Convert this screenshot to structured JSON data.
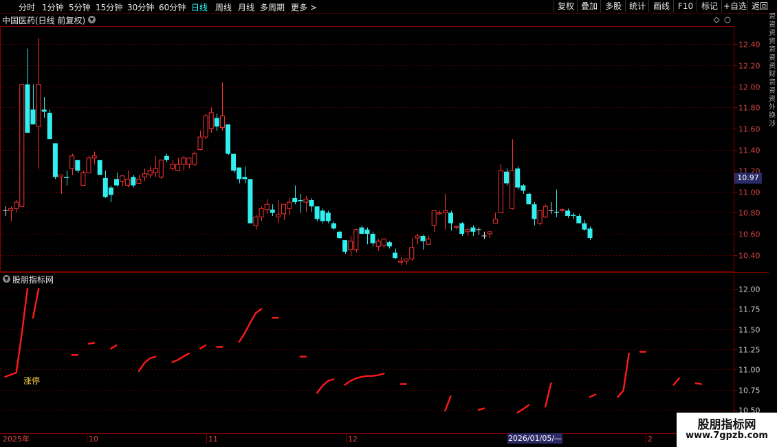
{
  "toolbar": {
    "periods": [
      "分时",
      "1分钟",
      "5分钟",
      "15分钟",
      "30分钟",
      "60分钟",
      "日线",
      "周线",
      "月线",
      "多周期",
      "更多 >"
    ],
    "active_period": "日线",
    "right_buttons": [
      "复权",
      "叠加",
      "多股",
      "统计",
      "画线",
      "F10",
      "标记",
      "+自选",
      "返回"
    ]
  },
  "upper_title": "中国医药(日线 前复权)",
  "lower_title": "股朋指标网",
  "current_price_label": "10.97",
  "crosshair_date": "2026/01/05/—",
  "limit_up_label": "涨停",
  "watermark": {
    "line1": "股朋指标网",
    "line2": "www.7gpzb.com"
  },
  "x_axis_labels": [
    "2025年",
    "10",
    "11",
    "12",
    "2"
  ],
  "right_strip_text": "资资资资资资资财资资资外换涉",
  "colors": {
    "up": "#ff3333",
    "down": "#33eeee",
    "line": "#ff1a1a",
    "grid": "#5a0000",
    "frame": "#8a0000"
  },
  "chart_data": [
    {
      "type": "candlestick",
      "title": "中国医药(日线 前复权)",
      "y_ticks": [
        "12.40",
        "12.20",
        "12.00",
        "11.80",
        "11.60",
        "11.40",
        "11.20",
        "11.00",
        "10.80",
        "10.60",
        "10.40"
      ],
      "ylim": [
        10.26,
        12.56
      ],
      "candles": [
        [
          10.82,
          10.86,
          10.77,
          10.82
        ],
        [
          10.82,
          10.86,
          10.72,
          10.84
        ],
        [
          10.84,
          10.92,
          10.8,
          10.9
        ],
        [
          10.86,
          12.02,
          10.86,
          12.02
        ],
        [
          12.02,
          12.36,
          11.56,
          11.56
        ],
        [
          11.78,
          12.02,
          11.64,
          11.64
        ],
        [
          11.62,
          12.46,
          11.22,
          12.02
        ],
        [
          11.78,
          11.9,
          11.7,
          11.76
        ],
        [
          11.75,
          11.78,
          11.5,
          11.5
        ],
        [
          11.46,
          11.46,
          11.12,
          11.14
        ],
        [
          11.14,
          11.16,
          10.98,
          11.16
        ],
        [
          11.14,
          11.2,
          11.06,
          11.13
        ],
        [
          11.22,
          11.36,
          11.16,
          11.34
        ],
        [
          11.3,
          11.3,
          11.18,
          11.2
        ],
        [
          11.06,
          11.2,
          11.06,
          11.18
        ],
        [
          11.18,
          11.34,
          11.18,
          11.32
        ],
        [
          11.32,
          11.38,
          11.26,
          11.34
        ],
        [
          11.3,
          11.3,
          11.16,
          11.16
        ],
        [
          11.13,
          11.2,
          10.94,
          10.95
        ],
        [
          11.04,
          11.06,
          10.9,
          10.97
        ],
        [
          11.12,
          11.18,
          11.05,
          11.06
        ],
        [
          11.1,
          11.16,
          11.05,
          11.15
        ],
        [
          11.06,
          11.2,
          11.04,
          11.12
        ],
        [
          11.14,
          11.16,
          11.04,
          11.06
        ],
        [
          11.08,
          11.16,
          11.07,
          11.12
        ],
        [
          11.14,
          11.22,
          11.1,
          11.17
        ],
        [
          11.16,
          11.24,
          11.13,
          11.2
        ],
        [
          11.18,
          11.34,
          11.14,
          11.22
        ],
        [
          11.14,
          11.3,
          11.12,
          11.3
        ],
        [
          11.34,
          11.36,
          11.28,
          11.3
        ],
        [
          11.22,
          11.3,
          11.2,
          11.26
        ],
        [
          11.2,
          11.32,
          11.2,
          11.26
        ],
        [
          11.26,
          11.34,
          11.2,
          11.32
        ],
        [
          11.26,
          11.32,
          11.22,
          11.32
        ],
        [
          11.26,
          11.38,
          11.24,
          11.36
        ],
        [
          11.4,
          11.58,
          11.4,
          11.52
        ],
        [
          11.52,
          11.74,
          11.5,
          11.72
        ],
        [
          11.6,
          11.8,
          11.56,
          11.75
        ],
        [
          11.7,
          11.74,
          11.58,
          11.62
        ],
        [
          11.61,
          12.04,
          11.58,
          11.72
        ],
        [
          11.64,
          11.64,
          11.35,
          11.36
        ],
        [
          11.36,
          11.36,
          11.18,
          11.2
        ],
        [
          11.23,
          11.23,
          11.08,
          11.12
        ],
        [
          11.14,
          11.24,
          11.08,
          11.12
        ],
        [
          11.12,
          11.12,
          10.7,
          10.7
        ],
        [
          10.68,
          10.78,
          10.64,
          10.76
        ],
        [
          10.76,
          10.86,
          10.72,
          10.84
        ],
        [
          10.83,
          10.93,
          10.79,
          10.88
        ],
        [
          10.83,
          10.88,
          10.77,
          10.8
        ],
        [
          10.76,
          10.92,
          10.7,
          10.78
        ],
        [
          10.79,
          10.88,
          10.73,
          10.88
        ],
        [
          10.84,
          10.94,
          10.78,
          10.9
        ],
        [
          10.94,
          11.06,
          10.88,
          10.9
        ],
        [
          10.92,
          10.98,
          10.8,
          10.91
        ],
        [
          10.9,
          10.96,
          10.81,
          10.93
        ],
        [
          10.92,
          10.94,
          10.81,
          10.86
        ],
        [
          10.86,
          10.86,
          10.72,
          10.74
        ],
        [
          10.82,
          10.84,
          10.7,
          10.72
        ],
        [
          10.8,
          10.82,
          10.7,
          10.72
        ],
        [
          10.7,
          10.72,
          10.64,
          10.65
        ],
        [
          10.62,
          10.63,
          10.55,
          10.56
        ],
        [
          10.54,
          10.54,
          10.41,
          10.43
        ],
        [
          10.45,
          10.58,
          10.39,
          10.53
        ],
        [
          10.45,
          10.65,
          10.42,
          10.64
        ],
        [
          10.66,
          10.68,
          10.6,
          10.6
        ],
        [
          10.64,
          10.66,
          10.5,
          10.6
        ],
        [
          10.6,
          10.62,
          10.48,
          10.51
        ],
        [
          10.48,
          10.55,
          10.44,
          10.53
        ],
        [
          10.49,
          10.56,
          10.46,
          10.55
        ],
        [
          10.52,
          10.53,
          10.46,
          10.48
        ],
        [
          10.42,
          10.46,
          10.36,
          10.37
        ],
        [
          10.33,
          10.38,
          10.3,
          10.34
        ],
        [
          10.34,
          10.36,
          10.31,
          10.36
        ],
        [
          10.36,
          10.56,
          10.34,
          10.47
        ],
        [
          10.56,
          10.6,
          10.5,
          10.58
        ],
        [
          10.58,
          10.59,
          10.45,
          10.53
        ],
        [
          10.5,
          10.58,
          10.5,
          10.55
        ],
        [
          10.68,
          10.82,
          10.62,
          10.82
        ],
        [
          10.79,
          10.82,
          10.78,
          10.8
        ],
        [
          10.8,
          10.98,
          10.64,
          10.82
        ],
        [
          10.8,
          10.82,
          10.63,
          10.7
        ],
        [
          10.66,
          10.68,
          10.64,
          10.67
        ],
        [
          10.7,
          10.71,
          10.58,
          10.6
        ],
        [
          10.62,
          10.66,
          10.58,
          10.64
        ],
        [
          10.66,
          10.68,
          10.58,
          10.62
        ],
        [
          10.64,
          10.66,
          10.59,
          10.64
        ],
        [
          10.58,
          10.62,
          10.55,
          10.58
        ],
        [
          10.6,
          10.61,
          10.56,
          10.62
        ],
        [
          10.7,
          10.8,
          10.7,
          10.74
        ],
        [
          10.8,
          11.26,
          10.8,
          11.2
        ],
        [
          11.19,
          11.22,
          11.06,
          11.08
        ],
        [
          10.84,
          11.5,
          10.83,
          11.2
        ],
        [
          11.22,
          11.24,
          11.02,
          11.04
        ],
        [
          11.06,
          11.07,
          10.98,
          11.01
        ],
        [
          10.98,
          10.99,
          10.88,
          10.88
        ],
        [
          10.88,
          10.9,
          10.68,
          10.74
        ],
        [
          10.7,
          10.82,
          10.68,
          10.82
        ],
        [
          10.76,
          10.88,
          10.75,
          10.86
        ],
        [
          10.82,
          10.9,
          10.79,
          10.82
        ],
        [
          10.81,
          11.02,
          10.76,
          10.8
        ],
        [
          10.82,
          10.84,
          10.8,
          10.83
        ],
        [
          10.82,
          10.84,
          10.75,
          10.77
        ],
        [
          10.78,
          10.8,
          10.74,
          10.77
        ],
        [
          10.77,
          10.79,
          10.7,
          10.7
        ],
        [
          10.7,
          10.73,
          10.63,
          10.64
        ],
        [
          10.65,
          10.67,
          10.54,
          10.56
        ]
      ]
    },
    {
      "type": "line",
      "title": "股朋指标网",
      "y_ticks": [
        "12.00",
        "11.75",
        "11.50",
        "11.25",
        "11.00",
        "10.75",
        "10.50"
      ],
      "ylim": [
        10.35,
        12.08
      ],
      "segments": [
        [
          [
            0,
            10.91
          ],
          [
            2,
            10.96
          ],
          [
            3,
            11.45
          ],
          [
            4,
            12.0
          ]
        ],
        [
          [
            5,
            11.64
          ],
          [
            6,
            12.0
          ]
        ],
        [
          [
            12,
            11.18
          ],
          [
            13,
            11.18
          ]
        ],
        [
          [
            15,
            11.32
          ],
          [
            16,
            11.33
          ]
        ],
        [
          [
            19,
            11.26
          ],
          [
            20,
            11.3
          ]
        ],
        [
          [
            24,
            10.98
          ],
          [
            25,
            11.08
          ],
          [
            26,
            11.14
          ],
          [
            27,
            11.16
          ]
        ],
        [
          [
            30,
            11.09
          ],
          [
            31,
            11.12
          ],
          [
            32,
            11.16
          ],
          [
            33,
            11.2
          ]
        ],
        [
          [
            35,
            11.26
          ],
          [
            36,
            11.3
          ]
        ],
        [
          [
            38,
            11.28
          ],
          [
            39,
            11.28
          ]
        ],
        [
          [
            42,
            11.34
          ],
          [
            43,
            11.45
          ],
          [
            44,
            11.58
          ],
          [
            45,
            11.7
          ],
          [
            46,
            11.75
          ]
        ],
        [
          [
            48,
            11.64
          ],
          [
            49,
            11.64
          ]
        ],
        [
          [
            53,
            11.16
          ],
          [
            54,
            11.16
          ]
        ],
        [
          [
            56,
            10.71
          ],
          [
            57,
            10.8
          ],
          [
            58,
            10.86
          ],
          [
            59,
            10.88
          ]
        ],
        [
          [
            61,
            10.81
          ],
          [
            62,
            10.86
          ],
          [
            63,
            10.89
          ],
          [
            64,
            10.91
          ],
          [
            65,
            10.92
          ],
          [
            66,
            10.92
          ],
          [
            67,
            10.93
          ],
          [
            68,
            10.95
          ]
        ],
        [
          [
            71,
            10.82
          ],
          [
            72,
            10.82
          ]
        ],
        [
          [
            79,
            10.49
          ],
          [
            80,
            10.67
          ]
        ],
        [
          [
            85,
            10.5
          ],
          [
            86,
            10.52
          ]
        ],
        [
          [
            92,
            10.43
          ],
          [
            93,
            10.51
          ],
          [
            94,
            10.56
          ]
        ],
        [
          [
            97,
            10.54
          ],
          [
            98,
            10.83
          ]
        ],
        [
          [
            105,
            10.66
          ],
          [
            106,
            10.69
          ]
        ],
        [
          [
            110,
            10.66
          ],
          [
            111,
            10.74
          ],
          [
            112,
            11.2
          ]
        ],
        [
          [
            114,
            11.22
          ],
          [
            115,
            11.22
          ]
        ],
        [
          [
            120,
            10.81
          ],
          [
            121,
            10.89
          ]
        ],
        [
          [
            124,
            10.83
          ],
          [
            125,
            10.82
          ]
        ]
      ]
    }
  ]
}
